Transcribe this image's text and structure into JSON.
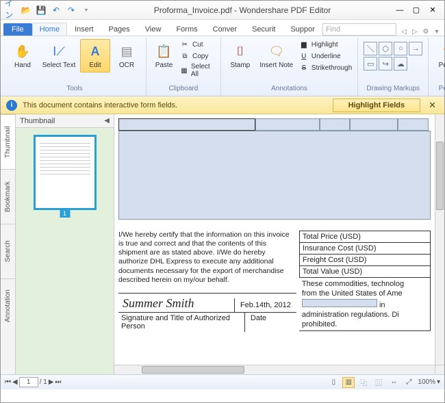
{
  "titlebar": {
    "title": "Proforma_Invoice.pdf - Wondershare PDF Editor"
  },
  "tabs": {
    "file": "File",
    "items": [
      "Home",
      "Insert",
      "Pages",
      "View",
      "Forms",
      "Conver",
      "Securit",
      "Suppor"
    ],
    "active": "Home",
    "find_placeholder": "Find"
  },
  "ribbon": {
    "tools": {
      "label": "Tools",
      "hand": "Hand",
      "select_text": "Select Text",
      "edit": "Edit",
      "ocr": "OCR"
    },
    "clipboard": {
      "label": "Clipboard",
      "paste": "Paste",
      "cut": "Cut",
      "copy": "Copy",
      "select_all": "Select All"
    },
    "annotations": {
      "label": "Annotations",
      "stamp": "Stamp",
      "insert_note": "Insert Note",
      "highlight": "Highlight",
      "underline": "Underline",
      "strikethrough": "Strikethrough"
    },
    "drawing": {
      "label": "Drawing Markups"
    },
    "pencil": {
      "label": "Pencil",
      "pencil": "Pencil"
    }
  },
  "infobar": {
    "message": "This document contains interactive form fields.",
    "button": "Highlight Fields"
  },
  "side": {
    "thumbnail": "Thumbnail",
    "bookmark": "Bookmark",
    "search": "Search",
    "annotation": "Annotation",
    "panel_title": "Thumbnail",
    "page1": "1"
  },
  "doc": {
    "cert": "I/We hereby certify that the information on this invoice is true and correct and that the contents of this shipment are as stated above.  I/We do hereby authorize DHL Express to execute any additional documents necessary for the export of merchandise described herein on my/our behalf.",
    "total_price": "Total Price (USD)",
    "insurance": "Insurance Cost (USD)",
    "freight": "Freight Cost (USD)",
    "total_value": "Total Value (USD)",
    "signature_name": "Summer Smith",
    "signature_date": "Feb.14th, 2012",
    "sig_label": "Signature and Title of Authorized Person",
    "date_label": "Date",
    "right_note_a": "These commodities, technolog",
    "right_note_b": "from the United States of Ame",
    "right_note_c": "in",
    "right_note_d": "administration regulations.  Di",
    "right_note_e": "prohibited."
  },
  "status": {
    "page_current": "1",
    "page_total": "/ 1",
    "zoom": "100%"
  }
}
